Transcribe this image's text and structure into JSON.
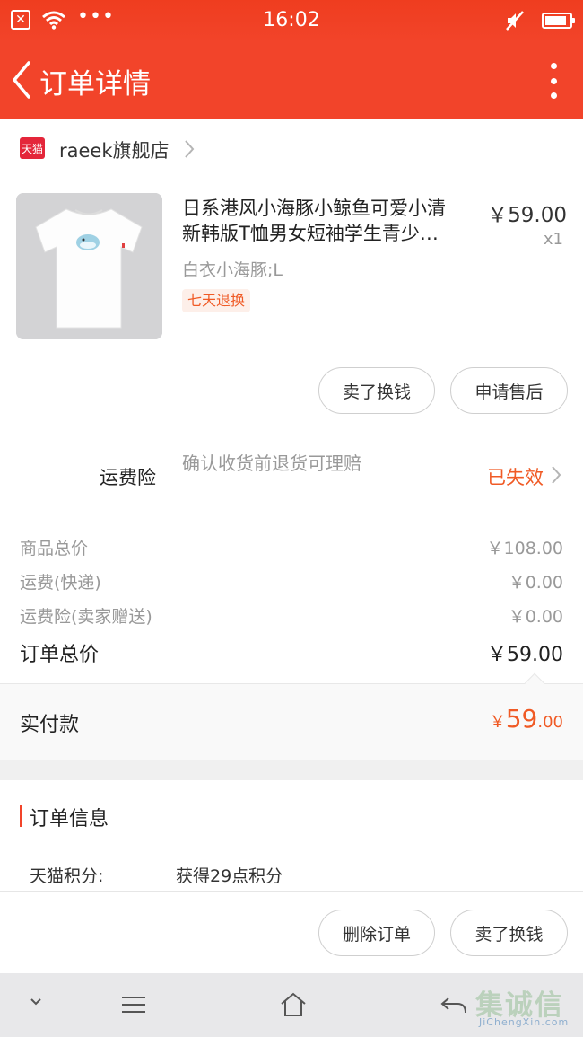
{
  "status_bar": {
    "time": "16:02",
    "dots": "•••"
  },
  "header": {
    "title": "订单详情"
  },
  "shop": {
    "logo_text": "天猫",
    "name": "raeek旗舰店"
  },
  "product": {
    "title_line1": "日系港风小海豚小鲸鱼可爱小清",
    "title_line2": "新韩版T恤男女短袖学生青少…",
    "price": "￥59.00",
    "quantity": "x1",
    "sku": "白衣小海豚;L",
    "tag": "七天退换"
  },
  "item_actions": {
    "sell_label": "卖了换钱",
    "after_sale_label": "申请售后"
  },
  "insurance": {
    "label": "运费险",
    "description": "确认收货前退货可理赔",
    "status": "已失效"
  },
  "summary": {
    "rows": [
      {
        "label": "商品总价",
        "value": "￥108.00"
      },
      {
        "label": "运费(快递)",
        "value": "￥0.00"
      },
      {
        "label": "运费险(卖家赠送)",
        "value": "￥0.00"
      }
    ],
    "total_label": "订单总价",
    "total_value": "￥59.00"
  },
  "payment": {
    "label": "实付款",
    "symbol": "￥",
    "integer": "59",
    "decimal": ".00"
  },
  "order_info": {
    "title": "订单信息",
    "points_key": "天猫积分:",
    "points_value": "获得29点积分"
  },
  "bottom_actions": {
    "delete_label": "删除订单",
    "sell_label": "卖了换钱"
  },
  "watermark": {
    "text": "集诚信",
    "sub": "JiChengXin.com"
  },
  "colors": {
    "brand": "#f2442a",
    "accent": "#f05a25",
    "tmall": "#e4263a"
  },
  "icons": [
    "close-box-icon",
    "wifi-icon",
    "mute-icon",
    "battery-icon",
    "back-arrow-icon",
    "more-vertical-icon",
    "tmall-logo-icon",
    "chevron-right-icon",
    "nav-down-icon",
    "nav-menu-icon",
    "nav-home-icon",
    "nav-back-icon"
  ]
}
